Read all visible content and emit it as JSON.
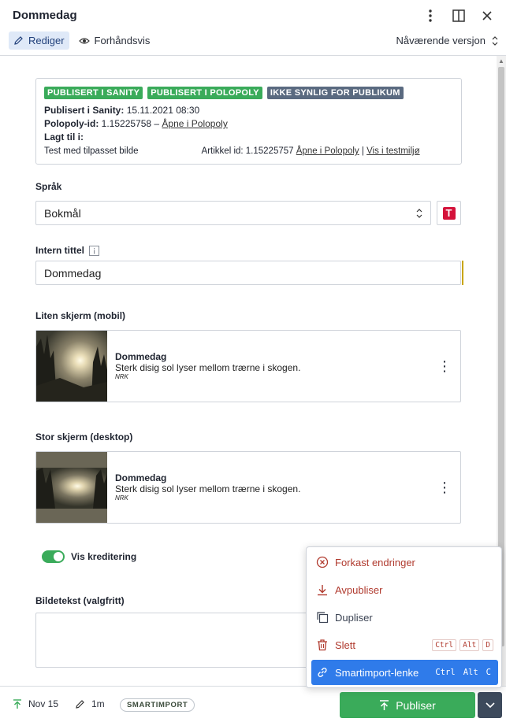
{
  "header": {
    "title": "Dommedag",
    "edit_label": "Rediger",
    "preview_label": "Forhåndsvis",
    "version_label": "Nåværende versjon"
  },
  "info": {
    "badges": [
      "PUBLISERT I SANITY",
      "PUBLISERT I POLOPOLY",
      "IKKE SYNLIG FOR PUBLIKUM"
    ],
    "sanity_label": "Publisert i Sanity:",
    "sanity_value": "15.11.2021 08:30",
    "polopoly_label": "Polopoly-id:",
    "polopoly_value": "1.15225758 –",
    "polopoly_link": "Åpne i Polopoly",
    "added_label": "Lagt til i:",
    "added_value": "Test med tilpasset bilde",
    "article_label": "Artikkel id: 1.15225757",
    "article_link": "Åpne i Polopoly",
    "separator": "|",
    "test_link": "Vis i testmiljø"
  },
  "language": {
    "label": "Språk",
    "value": "Bokmål",
    "translate_glyph": "T"
  },
  "internal_title": {
    "label": "Intern tittel",
    "value": "Dommedag"
  },
  "mobile": {
    "label": "Liten skjerm (mobil)",
    "title": "Dommedag",
    "desc": "Sterk disig sol lyser mellom trærne i skogen.",
    "source": "NRK"
  },
  "desktop": {
    "label": "Stor skjerm (desktop)",
    "title": "Dommedag",
    "desc": "Sterk disig sol lyser mellom trærne i skogen.",
    "source": "NRK"
  },
  "credit_toggle": {
    "label": "Vis kreditering",
    "on": true
  },
  "caption": {
    "label": "Bildetekst (valgfritt)",
    "value": ""
  },
  "menu": {
    "items": [
      {
        "label": "Forkast endringer",
        "icon": "discard-icon"
      },
      {
        "label": "Avpubliser",
        "icon": "download-icon"
      },
      {
        "label": "Dupliser",
        "icon": "copy-icon"
      },
      {
        "label": "Slett",
        "icon": "trash-icon",
        "keys": [
          "Ctrl",
          "Alt",
          "D"
        ]
      },
      {
        "label": "Smartimport-lenke",
        "icon": "link-icon",
        "keys": [
          "Ctrl",
          "Alt",
          "C"
        ]
      }
    ]
  },
  "footer": {
    "date": "Nov 15",
    "edited": "1m",
    "pill": "SMARTIMPORT",
    "publish": "Publiser"
  },
  "colors": {
    "green": "#3aab5a",
    "slate_badge": "#5a6a80",
    "accent_blue": "#2f7bea",
    "danger": "#b03a2e"
  }
}
